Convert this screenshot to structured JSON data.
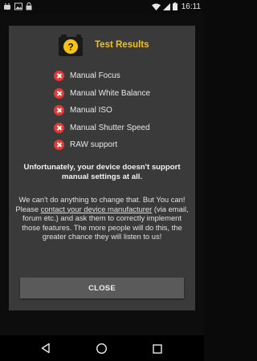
{
  "status_bar": {
    "time": "16:11",
    "left_icons": [
      "android-app-icon",
      "photo-icon",
      "lock-icon"
    ],
    "right_icons": [
      "wifi-icon",
      "signal-icon",
      "battery-icon"
    ]
  },
  "dialog": {
    "title": "Test Results",
    "app_icon": "camera-question-icon",
    "checks": [
      {
        "label": "Manual Focus",
        "status": "fail"
      },
      {
        "label": "Manual White Balance",
        "status": "fail"
      },
      {
        "label": "Manual ISO",
        "status": "fail"
      },
      {
        "label": "Manual Shutter Speed",
        "status": "fail"
      },
      {
        "label": "RAW support",
        "status": "fail"
      }
    ],
    "warning": "Unfortunately, your device doesn't support manual settings at all.",
    "message": {
      "before_link": "We can't do anything to change that. But You can! Please ",
      "link": "contact your device manufacturer",
      "after_link": " (via email, forum etc.) and ask them to correctly implement those features. The more people will do this, the greater chance they will listen to us!"
    },
    "close_label": "CLOSE"
  },
  "nav_bar": {
    "icons": [
      "back-icon",
      "home-icon",
      "recents-icon"
    ]
  },
  "colors": {
    "accent": "#f6c312",
    "fail": "#e53935",
    "dialog_bg": "#3a3a3a",
    "button_bg": "#5a5a5a"
  }
}
